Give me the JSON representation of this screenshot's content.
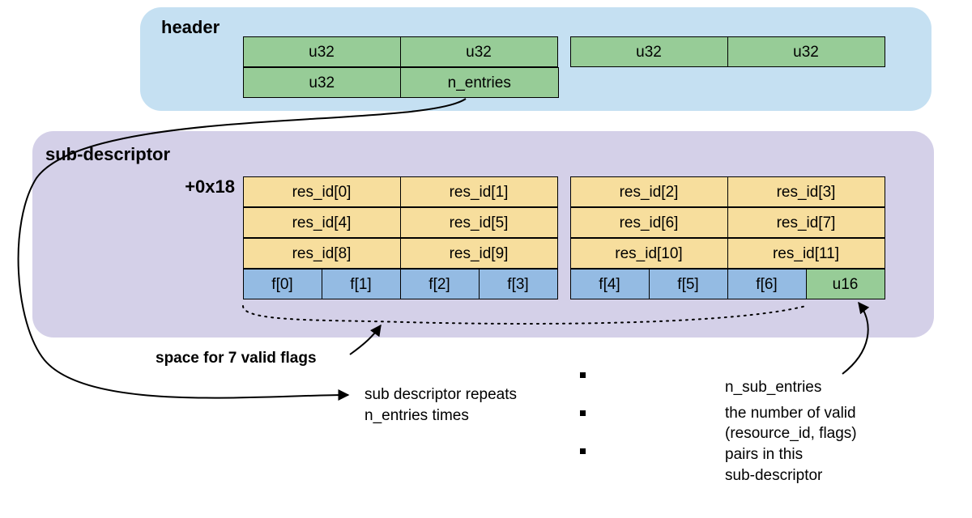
{
  "header": {
    "title": "header",
    "row1": [
      "u32",
      "u32",
      "u32",
      "u32"
    ],
    "row2": [
      "u32",
      "n_entries"
    ]
  },
  "sub": {
    "title": "sub-descriptor",
    "offset": "+0x18",
    "res_rows": [
      [
        "res_id[0]",
        "res_id[1]",
        "res_id[2]",
        "res_id[3]"
      ],
      [
        "res_id[4]",
        "res_id[5]",
        "res_id[6]",
        "res_id[7]"
      ],
      [
        "res_id[8]",
        "res_id[9]",
        "res_id[10]",
        "res_id[11]"
      ]
    ],
    "flag_row": [
      "f[0]",
      "f[1]",
      "f[2]",
      "f[3]",
      "f[4]",
      "f[5]",
      "f[6]",
      "u16"
    ]
  },
  "notes": {
    "flags": "space for 7 valid flags",
    "repeat_l1": "sub descriptor repeats",
    "repeat_l2": "n_entries times",
    "nsub_title": "n_sub_entries",
    "nsub_l1": "the number of valid",
    "nsub_l2": "(resource_id, flags)",
    "nsub_l3": "pairs in this",
    "nsub_l4": "sub-descriptor"
  }
}
